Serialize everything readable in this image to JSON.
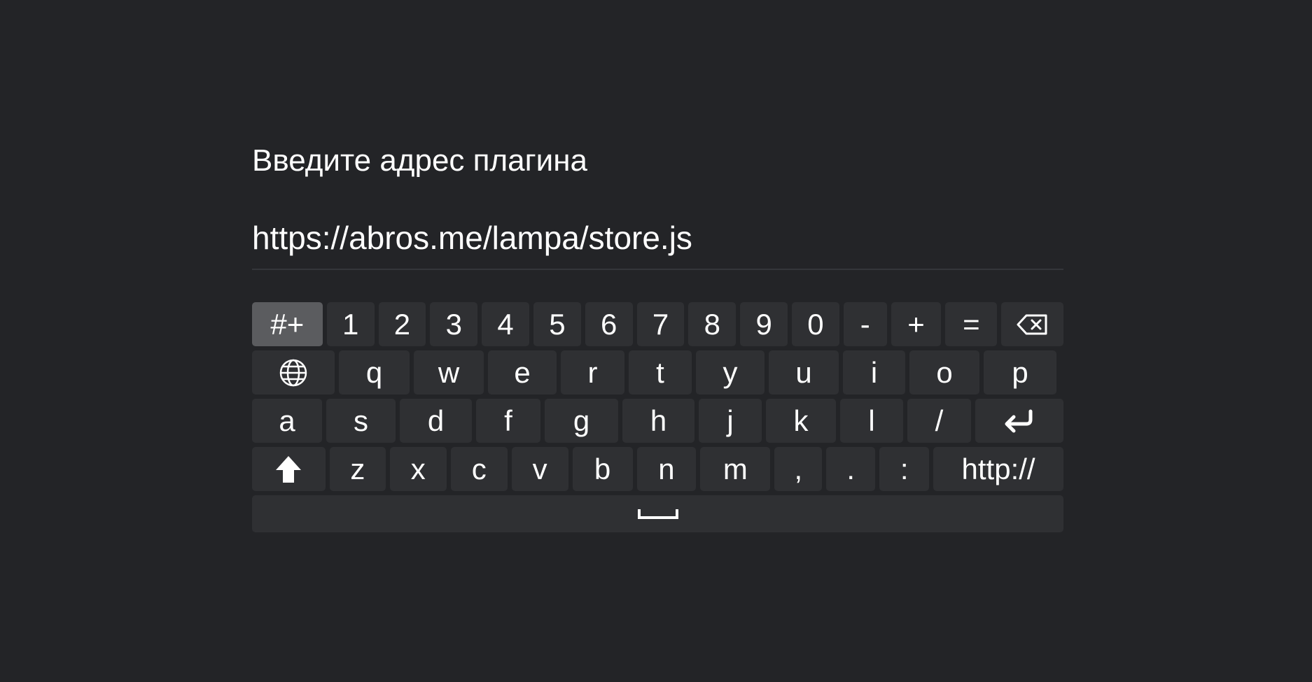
{
  "prompt": {
    "title": "Введите адрес плагина"
  },
  "input": {
    "value": "https://abros.me/lampa/store.js"
  },
  "keyboard": {
    "row1": [
      "#+",
      "1",
      "2",
      "3",
      "4",
      "5",
      "6",
      "7",
      "8",
      "9",
      "0",
      "-",
      "+",
      "="
    ],
    "row2": [
      "q",
      "w",
      "e",
      "r",
      "t",
      "y",
      "u",
      "i",
      "o",
      "p"
    ],
    "row3": [
      "a",
      "s",
      "d",
      "f",
      "g",
      "h",
      "j",
      "k",
      "l",
      "/"
    ],
    "row4": [
      "z",
      "x",
      "c",
      "v",
      "b",
      "n",
      "m",
      ",",
      ".",
      ":",
      "http://"
    ],
    "icons": {
      "backspace": "backspace-icon",
      "language": "globe-icon",
      "enter": "enter-icon",
      "shift": "shift-icon",
      "space": "space-icon"
    },
    "active_key": "#+",
    "colors": {
      "background": "#232427",
      "key": "#2f3033",
      "key_active": "#5b5c5f",
      "text": "#ffffff"
    }
  }
}
